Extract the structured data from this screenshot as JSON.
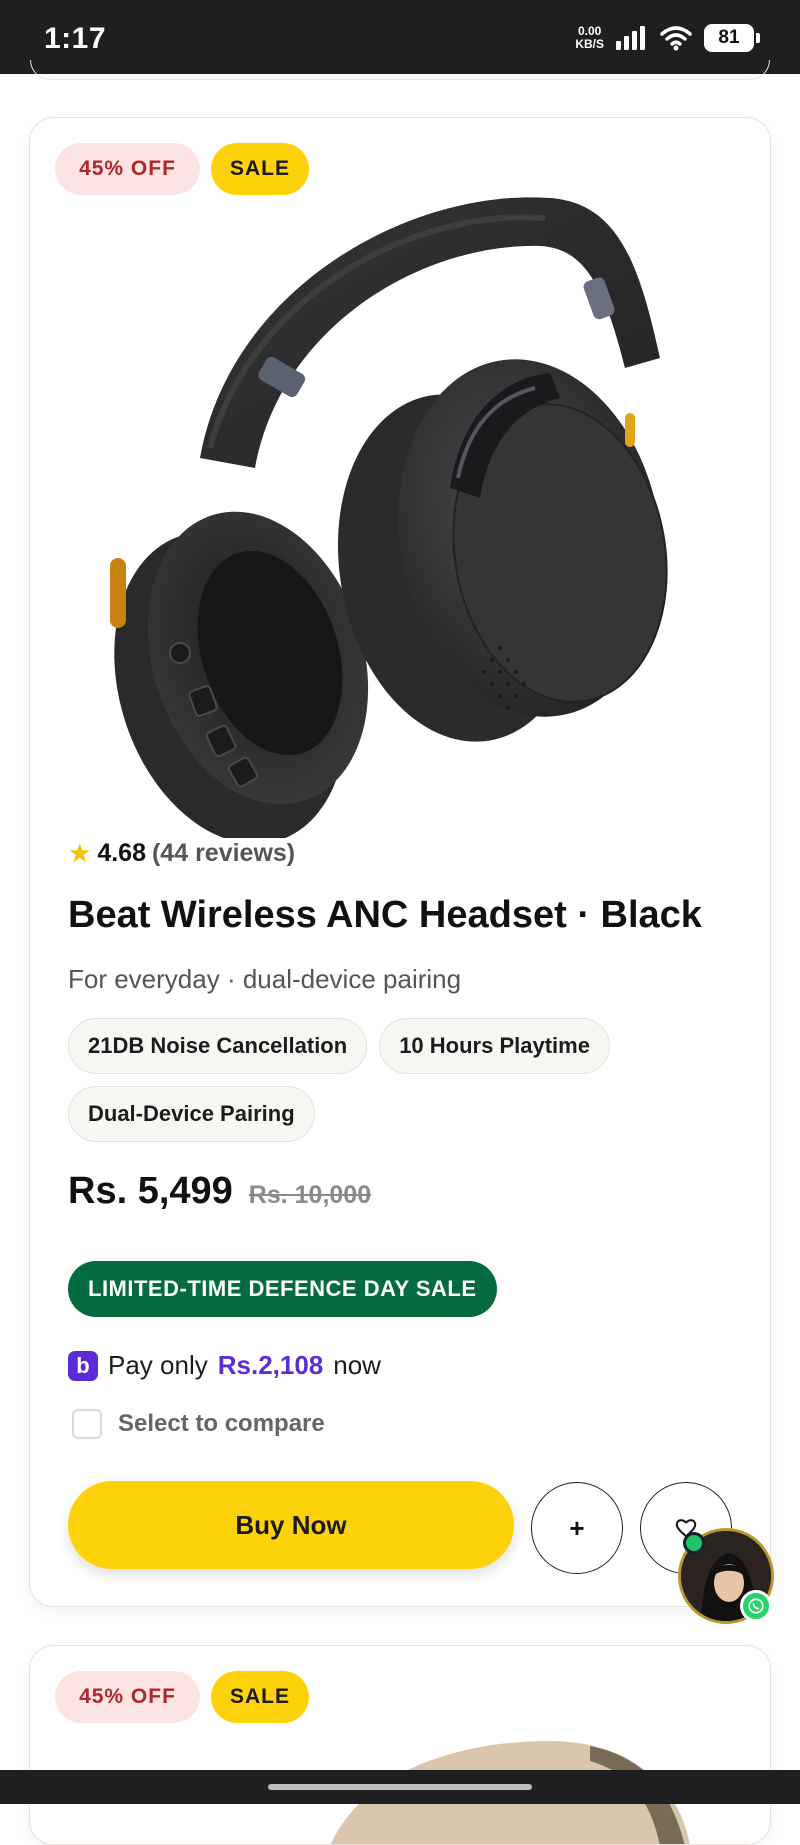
{
  "status_bar": {
    "time": "1:17",
    "net_speed_value": "0.00",
    "net_speed_unit": "KB/S",
    "battery": "81"
  },
  "product": {
    "discount_badge": "45% OFF",
    "sale_badge": "SALE",
    "image_alt": "Black over-ear wireless ANC headphones",
    "rating_value": "4.68",
    "rating_reviews": "(44 reviews)",
    "title": "Beat Wireless ANC Headset · Black",
    "subtitle": "For everyday · dual-device pairing",
    "features": [
      "21DB Noise Cancellation",
      "10 Hours Playtime",
      "Dual-Device Pairing"
    ],
    "price": "Rs. 5,499",
    "old_price": "Rs. 10,000",
    "promo_label": "LIMITED-TIME DEFENCE DAY SALE",
    "installment": {
      "prefix": "Pay only",
      "amount": "Rs.2,108",
      "suffix": "now"
    },
    "compare_label": "Select to compare",
    "buy_label": "Buy Now",
    "add_label": "+",
    "wishlist_icon": "heart-icon"
  },
  "next_product": {
    "discount_badge": "45% OFF",
    "sale_badge": "SALE"
  },
  "colors": {
    "accent_yellow": "#fdd20a",
    "promo_green": "#056b3e",
    "installment_purple": "#5b2bd6",
    "discount_red": "#b0262a"
  }
}
